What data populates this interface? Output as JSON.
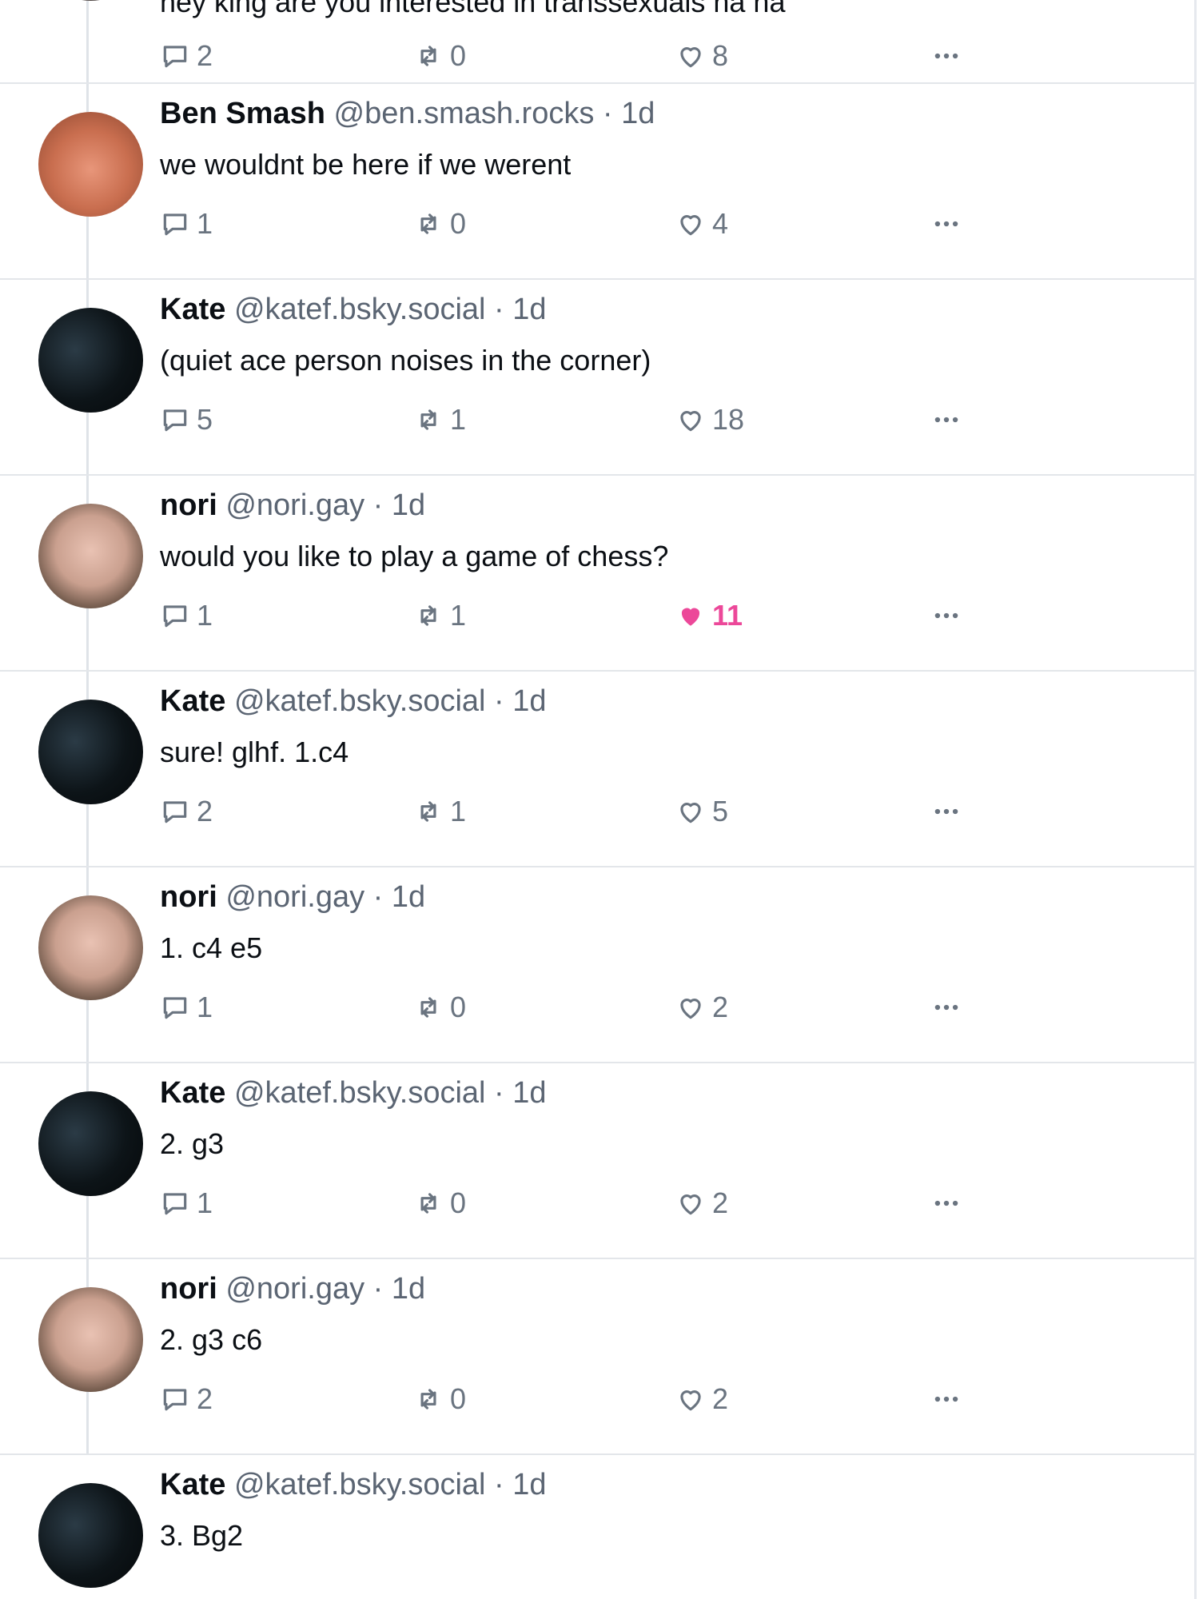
{
  "posts": [
    {
      "author": "",
      "handle": "",
      "time": "",
      "text": "hey king are you interested in transsexuals ha ha",
      "replies": "2",
      "reposts": "0",
      "likes": "8",
      "liked": false,
      "avatar": "top"
    },
    {
      "author": "Ben Smash",
      "handle": "@ben.smash.rocks",
      "time": "· 1d",
      "text": "we wouldnt be here if we werent",
      "replies": "1",
      "reposts": "0",
      "likes": "4",
      "liked": false,
      "avatar": "ben"
    },
    {
      "author": "Kate",
      "handle": "@katef.bsky.social",
      "time": "· 1d",
      "text": "(quiet ace person noises in the corner)",
      "replies": "5",
      "reposts": "1",
      "likes": "18",
      "liked": false,
      "avatar": "kate"
    },
    {
      "author": "nori",
      "handle": "@nori.gay",
      "time": "· 1d",
      "text": "would you like to play a game of chess?",
      "replies": "1",
      "reposts": "1",
      "likes": "11",
      "liked": true,
      "avatar": "nori"
    },
    {
      "author": "Kate",
      "handle": "@katef.bsky.social",
      "time": "· 1d",
      "text": "sure! glhf. 1.c4",
      "replies": "2",
      "reposts": "1",
      "likes": "5",
      "liked": false,
      "avatar": "kate"
    },
    {
      "author": "nori",
      "handle": "@nori.gay",
      "time": "· 1d",
      "text": "1. c4 e5",
      "replies": "1",
      "reposts": "0",
      "likes": "2",
      "liked": false,
      "avatar": "nori"
    },
    {
      "author": "Kate",
      "handle": "@katef.bsky.social",
      "time": "· 1d",
      "text": "2. g3",
      "replies": "1",
      "reposts": "0",
      "likes": "2",
      "liked": false,
      "avatar": "kate"
    },
    {
      "author": "nori",
      "handle": "@nori.gay",
      "time": "· 1d",
      "text": "2. g3 c6",
      "replies": "2",
      "reposts": "0",
      "likes": "2",
      "liked": false,
      "avatar": "nori"
    },
    {
      "author": "Kate",
      "handle": "@katef.bsky.social",
      "time": "· 1d",
      "text": "3. Bg2",
      "replies": "",
      "reposts": "",
      "likes": "",
      "liked": false,
      "avatar": "kate"
    }
  ],
  "icons": {
    "reply": "speech-bubble-icon",
    "repost": "repost-arrows-icon",
    "like": "heart-icon",
    "more": "ellipsis-icon"
  },
  "colors": {
    "liked": "#ec4899",
    "muted": "#6a7480",
    "divider": "#e3e6ea"
  }
}
